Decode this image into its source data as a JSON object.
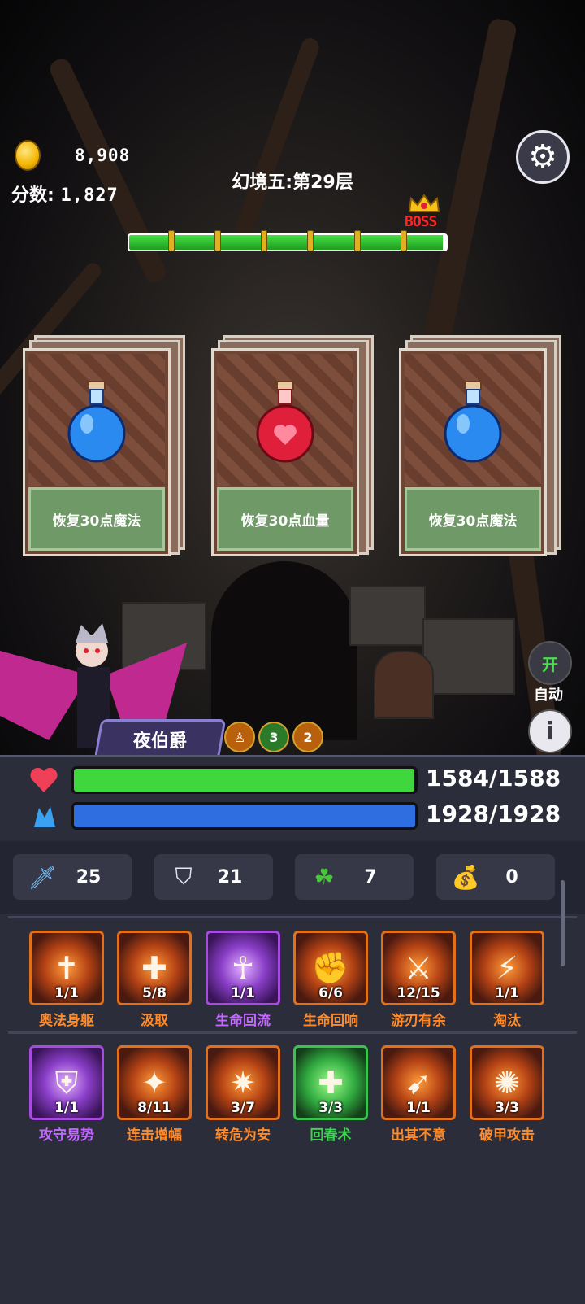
{
  "hud": {
    "coins": "8,908",
    "score_label": "分数:",
    "score_value": "1,827",
    "floor_title": "幻境五:第29层",
    "boss_label": "BOSS",
    "floor_progress": 0.99
  },
  "icons": {
    "settings": "gear-icon",
    "coin": "coin-icon",
    "crown": "crown-icon"
  },
  "cards": [
    {
      "label": "恢复30点魔法",
      "potion": "blue-potion-icon",
      "color": "#2a8af0"
    },
    {
      "label": "恢复30点血量",
      "potion": "red-potion-icon",
      "color": "#e0203a"
    },
    {
      "label": "恢复30点魔法",
      "potion": "blue-potion-icon",
      "color": "#2a8af0"
    }
  ],
  "side": {
    "auto_toggle": "开",
    "auto_label": "自动",
    "info": "i"
  },
  "hero": {
    "name": "夜伯爵",
    "buffs": [
      {
        "icon": "figure-buff-icon",
        "count": ""
      },
      {
        "icon": "skull-buff-icon",
        "count": "3"
      },
      {
        "icon": "sword-buff-icon",
        "count": "2"
      }
    ]
  },
  "vitals": {
    "hp_text": "1584/1588",
    "hp_fraction": 0.9975,
    "mp_text": "1928/1928",
    "mp_fraction": 1.0,
    "hp_color": "#3fd83c",
    "mp_color": "#2f6ee0"
  },
  "stats": [
    {
      "icon": "sword-icon",
      "value": "25"
    },
    {
      "icon": "shield-icon",
      "value": "21"
    },
    {
      "icon": "clover-icon",
      "value": "7"
    },
    {
      "icon": "money-bag-icon",
      "value": "0"
    }
  ],
  "skills_row1": [
    {
      "name": "奥法身躯",
      "count": "1/1",
      "icon": "winged-cross-icon",
      "tier": "orange"
    },
    {
      "name": "汲取",
      "count": "5/8",
      "icon": "drain-icon",
      "tier": "orange"
    },
    {
      "name": "生命回流",
      "count": "1/1",
      "icon": "praying-figure-icon",
      "tier": "purple"
    },
    {
      "name": "生命回响",
      "count": "6/6",
      "icon": "muscle-arm-icon",
      "tier": "orange"
    },
    {
      "name": "游刃有余",
      "count": "12/15",
      "icon": "swirl-sword-icon",
      "tier": "orange"
    },
    {
      "name": "淘汰",
      "count": "1/1",
      "icon": "slash-icon",
      "tier": "orange"
    }
  ],
  "skills_row2": [
    {
      "name": "攻守易势",
      "count": "1/1",
      "icon": "shield-burst-icon",
      "tier": "purple"
    },
    {
      "name": "连击增幅",
      "count": "8/11",
      "icon": "combo-fighter-icon",
      "tier": "orange"
    },
    {
      "name": "转危为安",
      "count": "3/7",
      "icon": "plus-burst-icon",
      "tier": "orange"
    },
    {
      "name": "回春术",
      "count": "3/3",
      "icon": "heal-plus-icon",
      "tier": "green"
    },
    {
      "name": "出其不意",
      "count": "1/1",
      "icon": "ambush-strike-icon",
      "tier": "orange"
    },
    {
      "name": "破甲攻击",
      "count": "3/3",
      "icon": "armor-pierce-icon",
      "tier": "orange"
    }
  ]
}
